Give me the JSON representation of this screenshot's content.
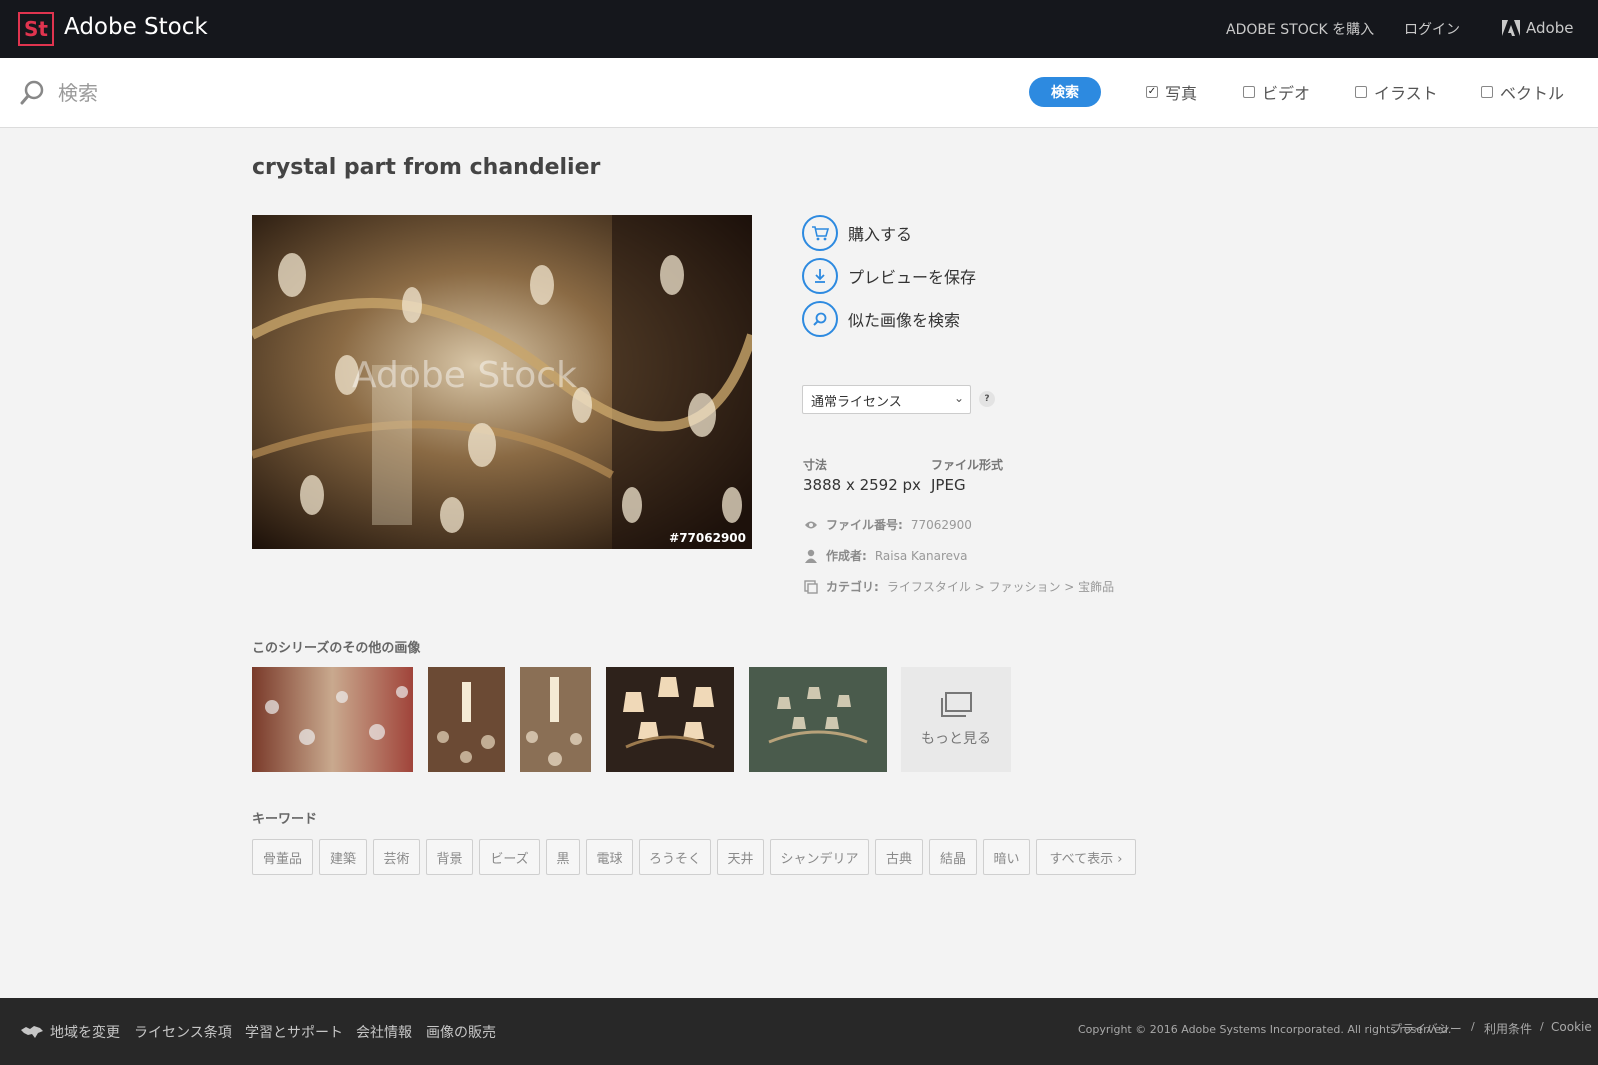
{
  "topbar": {
    "logo": "St",
    "brand": "Adobe Stock",
    "buy_link": "ADOBE STOCK を購入",
    "login_link": "ログイン",
    "adobe_link": "Adobe"
  },
  "search": {
    "placeholder": "検索",
    "button": "検索",
    "filters": [
      {
        "label": "写真",
        "checked": true
      },
      {
        "label": "ビデオ",
        "checked": false
      },
      {
        "label": "イラスト",
        "checked": false
      },
      {
        "label": "ベクトル",
        "checked": false
      }
    ]
  },
  "asset": {
    "title": "crystal part from chandelier",
    "image_id_badge": "#77062900",
    "watermark": "Adobe Stock",
    "actions": {
      "buy": "購入する",
      "save_preview": "プレビューを保存",
      "find_similar": "似た画像を検索"
    },
    "license_select": "通常ライセンス",
    "help": "?",
    "dimensions_label": "寸法",
    "dimensions_value": "3888 x 2592 px",
    "format_label": "ファイル形式",
    "format_value": "JPEG",
    "file_number_label": "ファイル番号:",
    "file_number_value": "77062900",
    "author_label": "作成者:",
    "author_value": "Raisa Kanareva",
    "category_label": "カテゴリ:",
    "category_value": "ライフスタイル > ファッション > 宝飾品"
  },
  "series": {
    "label": "このシリーズのその他の画像",
    "more": "もっと見る"
  },
  "keywords": {
    "label": "キーワード",
    "tags": [
      "骨董品",
      "建築",
      "芸術",
      "背景",
      "ビーズ",
      "黒",
      "電球",
      "ろうそく",
      "天井",
      "シャンデリア",
      "古典",
      "結晶",
      "暗い",
      "すべて表示 ›"
    ]
  },
  "footer": {
    "links": [
      "地域を変更",
      "ライセンス条項",
      "学習とサポート",
      "会社情報",
      "画像の販売"
    ],
    "copyright": "Copyright © 2016 Adobe Systems Incorporated. All rights reserved.",
    "privacy": "プライバシー",
    "sep1": "/",
    "terms": "利用条件",
    "sep2": "/",
    "cookie": "Cookie"
  },
  "colors": {
    "topbar_bg": "#15171c",
    "logo_accent": "#e0344f",
    "accent_blue": "#2d8ae0",
    "footer_bg": "#282828"
  }
}
